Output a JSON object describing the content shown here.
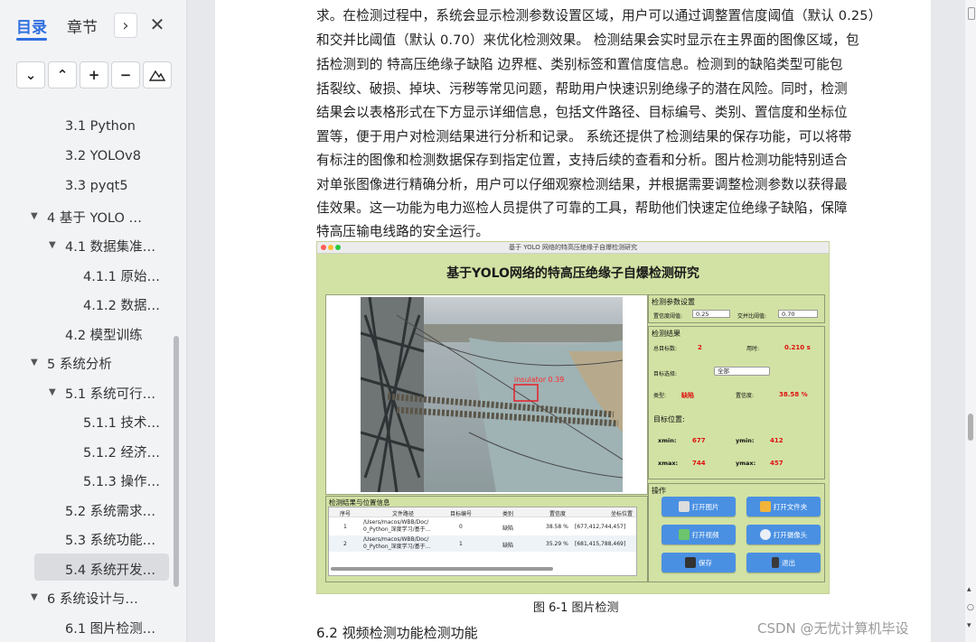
{
  "sidebar": {
    "tab_toc": "目录",
    "tab_chapter": "章节",
    "next_icon": "›",
    "close_icon": "✕",
    "tools": [
      "⌄",
      "⌃",
      "+",
      "−",
      "⛰"
    ],
    "items": [
      {
        "label": "3.1 Python",
        "level": 2,
        "expanded": null
      },
      {
        "label": "3.2 YOLOv8",
        "level": 2,
        "expanded": null
      },
      {
        "label": "3.3 pyqt5",
        "level": 2,
        "expanded": null
      },
      {
        "label": "4    基于 YOLO …",
        "level": 1,
        "expanded": true
      },
      {
        "label": "4.1 数据集准…",
        "level": 2,
        "expanded": true
      },
      {
        "label": "4.1.1  原始…",
        "level": 3,
        "expanded": null
      },
      {
        "label": "4.1.2  数据…",
        "level": 3,
        "expanded": null
      },
      {
        "label": "4.2 模型训练",
        "level": 2,
        "expanded": null
      },
      {
        "label": "5    系统分析",
        "level": 1,
        "expanded": true
      },
      {
        "label": "5.1 系统可行…",
        "level": 2,
        "expanded": true
      },
      {
        "label": "5.1.1  技术…",
        "level": 3,
        "expanded": null
      },
      {
        "label": "5.1.2  经济…",
        "level": 3,
        "expanded": null
      },
      {
        "label": "5.1.3  操作…",
        "level": 3,
        "expanded": null
      },
      {
        "label": "5.2 系统需求…",
        "level": 2,
        "expanded": null
      },
      {
        "label": "5.3 系统功能…",
        "level": 2,
        "expanded": null
      },
      {
        "label": "5.4 系统开发…",
        "level": 2,
        "expanded": null
      },
      {
        "label": "6    系统设计与…",
        "level": 1,
        "expanded": true
      },
      {
        "label": "6.1 图片检测…",
        "level": 2,
        "expanded": null
      }
    ],
    "active_index": 15
  },
  "doc": {
    "lines": [
      "求。在检测过程中，系统会显示检测参数设置区域，用户可以通过调整置信度阈值（默认 0.25）",
      "和交并比阈值（默认 0.70）来优化检测效果。  检测结果会实时显示在主界面的图像区域，包",
      "括检测到的  特高压绝缘子缺陷  边界框、类别标签和置信度信息。检测到的缺陷类型可能包",
      "括裂纹、破损、掉块、污秽等常见问题，帮助用户快速识别绝缘子的潜在风险。同时，检测",
      "结果会以表格形式在下方显示详细信息，包括文件路径、目标编号、类别、置信度和坐标位",
      "置等，便于用户对检测结果进行分析和记录。  系统还提供了检测结果的保存功能，可以将带",
      "有标注的图像和检测数据保存到指定位置，支持后续的查看和分析。图片检测功能特别适合",
      "对单张图像进行精确分析，用户可以仔细观察检测结果，并根据需要调整检测参数以获得最",
      "佳效果。这一功能为电力巡检人员提供了可靠的工具，帮助他们快速定位绝缘子缺陷，保障",
      "特高压输电线路的安全运行。"
    ],
    "caption": "图 6-1  图片检测",
    "next_heading": "6.2 视频检测功能检测功能",
    "watermark": "CSDN @无忧计算机毕设"
  },
  "figure": {
    "window_title": "基于 YOLO 网络的特高压绝缘子自爆检测研究",
    "main_title": "基于YOLO网络的特高压绝缘子自爆检测研究",
    "params": {
      "heading": "检测参数设置",
      "conf_label": "置信度阈值:",
      "conf_value": "0.25",
      "iou_label": "交并比阈值:",
      "iou_value": "0.70"
    },
    "results": {
      "heading": "检测结果",
      "total_label": "总目标数:",
      "total_value": "2",
      "time_label": "用时:",
      "time_value": "0.210 s",
      "target_label": "目标选择:",
      "target_value": "全部",
      "type_label": "类型:",
      "type_value": "缺陷",
      "conf_label": "置信度:",
      "conf_value": "38.58 %"
    },
    "position": {
      "heading": "目标位置:",
      "xmin_label": "xmin:",
      "xmin": "677",
      "ymin_label": "ymin:",
      "ymin": "412",
      "xmax_label": "xmax:",
      "xmax": "744",
      "ymax_label": "ymax:",
      "ymax": "457"
    },
    "ops": {
      "heading": "操作",
      "open_image": "打开图片",
      "open_folder": "打开文件夹",
      "open_video": "打开视频",
      "open_camera": "打开摄像头",
      "save": "保存",
      "exit": "退出"
    },
    "detection_label": "insulator  0.39",
    "table": {
      "heading": "检测结果与位置信息",
      "headers": [
        "序号",
        "文件路径",
        "目标编号",
        "类别",
        "置信度",
        "坐标位置"
      ],
      "rows": [
        [
          "1",
          "/Users/macos/WBB/Doc/\n0_Python_深度学习/基于…",
          "0",
          "缺陷",
          "38.58 %",
          "[677,412,744,457]"
        ],
        [
          "2",
          "/Users/macos/WBB/Doc/\n0_Python_深度学习/基于…",
          "1",
          "缺陷",
          "35.29 %",
          "[681,415,788,469]"
        ]
      ]
    }
  }
}
